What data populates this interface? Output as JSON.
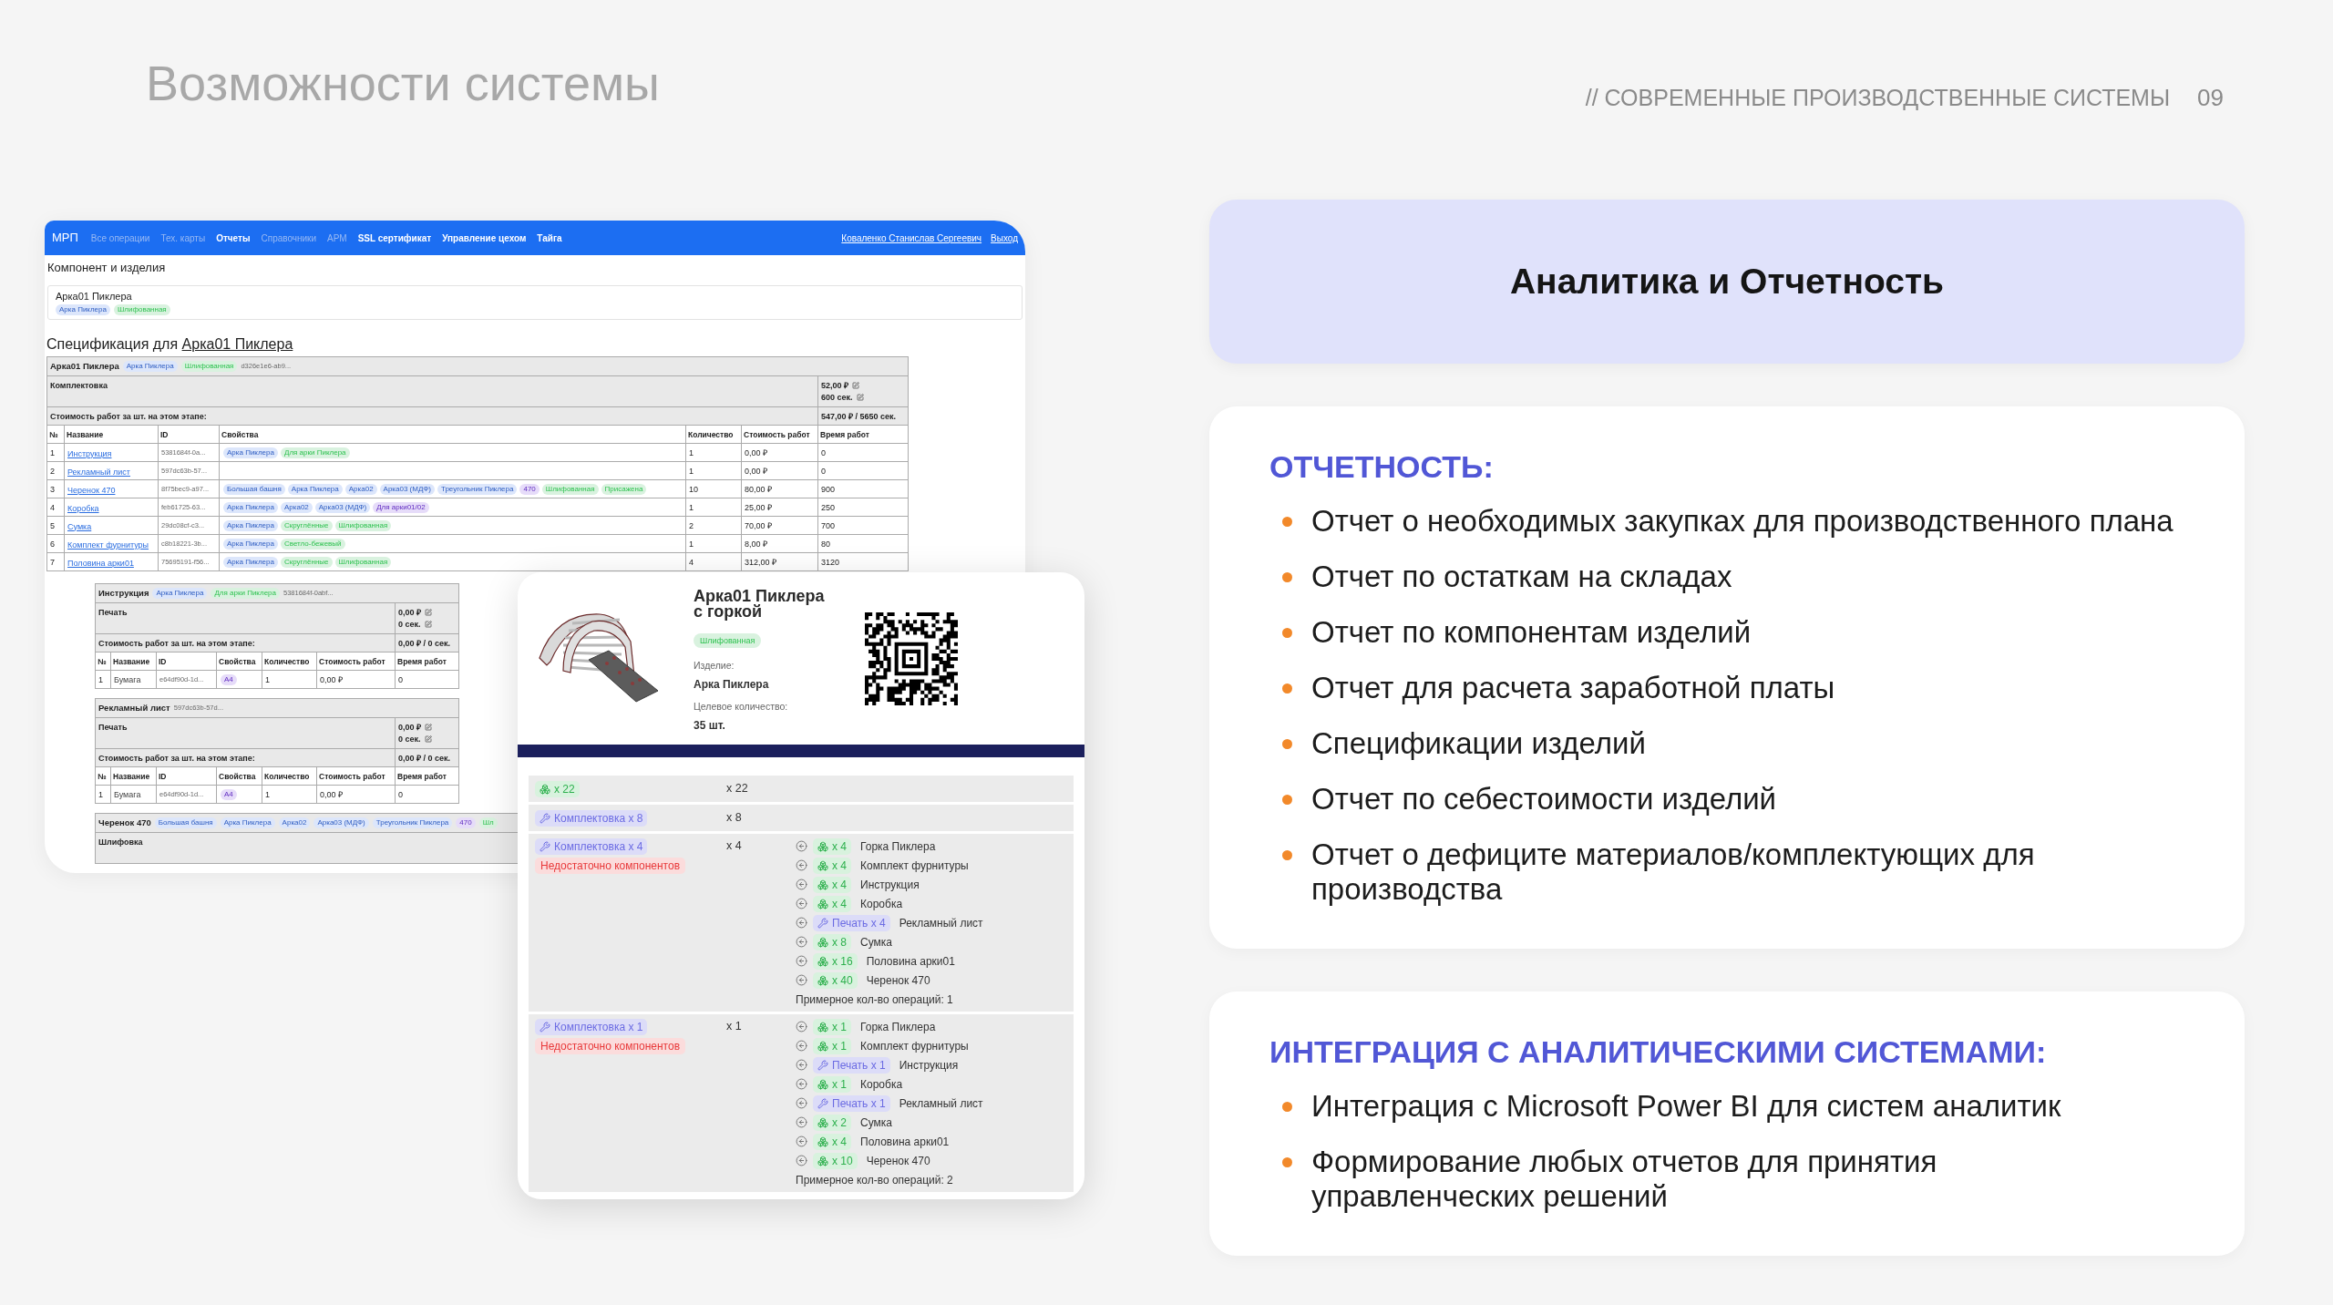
{
  "header": {
    "title": "Возможности системы",
    "subtitle": "// СОВРЕМЕННЫЕ ПРОИЗВОДСТВЕННЫЕ СИСТЕМЫ",
    "page_number": "09"
  },
  "app_screenshot": {
    "nav": {
      "brand": "МРП",
      "items": [
        {
          "label": "Все операции",
          "disabled": true
        },
        {
          "label": "Тех. карты",
          "disabled": true
        },
        {
          "label": "Отчеты",
          "disabled": false
        },
        {
          "label": "Справочники",
          "disabled": true
        },
        {
          "label": "АРМ",
          "disabled": true
        },
        {
          "label": "SSL сертификат",
          "disabled": false
        },
        {
          "label": "Управление цехом",
          "disabled": false
        },
        {
          "label": "Тайга",
          "disabled": false
        }
      ],
      "user": "Коваленко Станислав Сергеевич",
      "logout": "Выход"
    },
    "page_title": "Компонент и изделия",
    "product": {
      "name": "Арка01 Пиклера",
      "tags": [
        {
          "label": "Арка Пиклера",
          "color": "#dce6fb"
        },
        {
          "label": "Шлифованная",
          "color": "#d9f2df"
        }
      ]
    },
    "spec_heading": {
      "text": "Спецификация для",
      "link": "Арка01 Пиклера"
    },
    "spec": {
      "name": "Арка01 Пиклера",
      "tags": [
        {
          "label": "Арка Пиклера",
          "color": "#dce6fb"
        },
        {
          "label": "Шлифованная",
          "color": "#d9f2df"
        }
      ],
      "id": "d326e1e6-ab9...",
      "stage": "Комплектовка",
      "stage_cost": "52,00 ₽",
      "stage_time": "600 сек.",
      "total_label": "Стоимость работ за шт. на этом этапе:",
      "total_value": "547,00 ₽ / 5650 сек.",
      "columns": [
        "№",
        "Название",
        "ID",
        "Свойства",
        "Количество",
        "Стоимость работ",
        "Время работ"
      ],
      "rows": [
        {
          "number": "1",
          "name": "Инструкция",
          "id": "5381684f-0a...",
          "tags": [
            {
              "label": "Арка Пиклера",
              "color": "#dce6fb"
            },
            {
              "label": "Для арки Пиклера",
              "color": "#d9f2df"
            }
          ],
          "quantity": "1",
          "cost": "0,00 ₽",
          "time": "0"
        },
        {
          "number": "2",
          "name": "Рекламный лист",
          "id": "597dc63b-57...",
          "quantity": "1",
          "cost": "0,00 ₽",
          "time": "0"
        },
        {
          "number": "3",
          "name": "Черенок 470",
          "id": "8f75bec9-a97...",
          "tags": [
            {
              "label": "Большая башня",
              "color": "#dce6fb"
            },
            {
              "label": "Арка Пиклера",
              "color": "#dce6fb"
            },
            {
              "label": "Арка02",
              "color": "#dce6fb"
            },
            {
              "label": "Арка03 (МДФ)",
              "color": "#dce6fb"
            },
            {
              "label": "Треугольник Пиклера",
              "color": "#dce6fb"
            },
            {
              "label": "470",
              "color": "#e6dcf9"
            },
            {
              "label": "Шлифованная",
              "color": "#d9f2df"
            },
            {
              "label": "Присажена",
              "color": "#d9f2df"
            }
          ],
          "quantity": "10",
          "cost": "80,00 ₽",
          "time": "900"
        },
        {
          "number": "4",
          "name": "Коробка",
          "id": "feb61725-63...",
          "tags": [
            {
              "label": "Арка Пиклера",
              "color": "#dce6fb"
            },
            {
              "label": "Арка02",
              "color": "#dce6fb"
            },
            {
              "label": "Арка03 (МДФ)",
              "color": "#dce6fb"
            },
            {
              "label": "Для арки01/02",
              "color": "#e6dcf9"
            }
          ],
          "quantity": "1",
          "cost": "25,00 ₽",
          "time": "250"
        },
        {
          "number": "5",
          "name": "Сумка",
          "id": "29dc08cf-c3...",
          "tags": [
            {
              "label": "Арка Пиклера",
              "color": "#dce6fb"
            },
            {
              "label": "Скруглённые",
              "color": "#d9f2df"
            },
            {
              "label": "Шлифованная",
              "color": "#d9f2df"
            }
          ],
          "quantity": "2",
          "cost": "70,00 ₽",
          "time": "700"
        },
        {
          "number": "6",
          "name": "Комплект фурнитуры",
          "id": "c8b18221-3b...",
          "tags": [
            {
              "label": "Арка Пиклера",
              "color": "#dce6fb"
            },
            {
              "label": "Светло-бежевый",
              "color": "#d9f2df"
            }
          ],
          "quantity": "1",
          "cost": "8,00 ₽",
          "time": "80"
        },
        {
          "number": "7",
          "name": "Половина арки01",
          "id": "75695191-f56...",
          "tags": [
            {
              "label": "Арка Пиклера",
              "color": "#dce6fb"
            },
            {
              "label": "Скруглённые",
              "color": "#d9f2df"
            },
            {
              "label": "Шлифованная",
              "color": "#d9f2df"
            }
          ],
          "quantity": "4",
          "cost": "312,00 ₽",
          "time": "3120"
        }
      ]
    },
    "sub_specs": [
      {
        "name": "Инструкция",
        "tags": [
          {
            "label": "Арка Пиклера",
            "color": "#dce6fb"
          },
          {
            "label": "Для арки Пиклера",
            "color": "#d9f2df"
          }
        ],
        "id": "5381684f-0abf...",
        "stage": "Печать",
        "stage_cost": "0,00 ₽",
        "stage_time": "0 сек.",
        "total_label": "Стоимость работ за шт. на этом этапе:",
        "total_value": "0,00 ₽ / 0 сек.",
        "columns": [
          "№",
          "Название",
          "ID",
          "Свойства",
          "Количество",
          "Стоимость работ",
          "Время работ"
        ],
        "rows": [
          {
            "number": "1",
            "name": "Бумага",
            "id": "e64df90d-1d...",
            "tags": [
              {
                "label": "А4",
                "color": "#e6dcf9"
              }
            ],
            "quantity": "1",
            "cost": "0,00 ₽",
            "time": "0"
          }
        ]
      },
      {
        "name": "Рекламный лист",
        "id": "597dc63b-57d...",
        "stage": "Печать",
        "stage_cost": "0,00 ₽",
        "stage_time": "0 сек.",
        "total_label": "Стоимость работ за шт. на этом этапе:",
        "total_value": "0,00 ₽ / 0 сек.",
        "columns": [
          "№",
          "Название",
          "ID",
          "Свойства",
          "Количество",
          "Стоимость работ",
          "Время работ"
        ],
        "rows": [
          {
            "number": "1",
            "name": "Бумага",
            "id": "e64df90d-1d...",
            "tags": [
              {
                "label": "А4",
                "color": "#e6dcf9"
              }
            ],
            "quantity": "1",
            "cost": "0,00 ₽",
            "time": "0"
          }
        ]
      },
      {
        "name": "Черенок 470",
        "tags": [
          {
            "label": "Большая башня",
            "color": "#dce6fb"
          },
          {
            "label": "Арка Пиклера",
            "color": "#dce6fb"
          },
          {
            "label": "Арка02",
            "color": "#dce6fb"
          },
          {
            "label": "Арка03 (МДФ)",
            "color": "#dce6fb"
          },
          {
            "label": "Треугольник Пиклера",
            "color": "#dce6fb"
          },
          {
            "label": "470",
            "color": "#e6dcf9"
          },
          {
            "label": "Шл",
            "color": "#d9f2df"
          }
        ],
        "stage": "Шлифовка"
      }
    ]
  },
  "task_card": {
    "title": "Арка01 Пиклера с горкой",
    "tag": {
      "label": "Шлифованная",
      "color": "#d9f2df"
    },
    "fields": [
      {
        "label": "Изделие:",
        "value": "Арка Пиклера"
      },
      {
        "label": "Целевое количество:",
        "value": "35 шт."
      }
    ],
    "operations": [
      {
        "badge": {
          "kind": "stock",
          "text": "x 22"
        },
        "quantity": "x 22"
      },
      {
        "badge": {
          "kind": "operation",
          "text": "Комплектовка x 8"
        },
        "quantity": "x 8"
      },
      {
        "badge": {
          "kind": "operation",
          "text": "Комплектовка x 4"
        },
        "warning": "Недостаточно компонентов",
        "quantity": "x 4",
        "components": [
          {
            "kind": "stock",
            "badge": "x 4",
            "name": "Горка Пиклера"
          },
          {
            "kind": "stock",
            "badge": "x 4",
            "name": "Комплект фурнитуры"
          },
          {
            "kind": "stock",
            "badge": "x 4",
            "name": "Инструкция"
          },
          {
            "kind": "stock",
            "badge": "x 4",
            "name": "Коробка"
          },
          {
            "kind": "operation",
            "badge": "Печать x 4",
            "name": "Рекламный лист"
          },
          {
            "kind": "stock",
            "badge": "x 8",
            "name": "Сумка"
          },
          {
            "kind": "stock",
            "badge": "x 16",
            "name": "Половина арки01"
          },
          {
            "kind": "stock",
            "badge": "x 40",
            "name": "Черенок 470"
          }
        ],
        "estimate": "Примерное кол-во операций: 1"
      },
      {
        "badge": {
          "kind": "operation",
          "text": "Комплектовка x 1"
        },
        "warning": "Недостаточно компонентов",
        "quantity": "x 1",
        "components": [
          {
            "kind": "stock",
            "badge": "x 1",
            "name": "Горка Пиклера"
          },
          {
            "kind": "stock",
            "badge": "x 1",
            "name": "Комплект фурнитуры"
          },
          {
            "kind": "operation",
            "badge": "Печать x 1",
            "name": "Инструкция"
          },
          {
            "kind": "stock",
            "badge": "x 1",
            "name": "Коробка"
          },
          {
            "kind": "operation",
            "badge": "Печать x 1",
            "name": "Рекламный лист"
          },
          {
            "kind": "stock",
            "badge": "x 2",
            "name": "Сумка"
          },
          {
            "kind": "stock",
            "badge": "x 4",
            "name": "Половина арки01"
          },
          {
            "kind": "stock",
            "badge": "x 10",
            "name": "Черенок 470"
          }
        ],
        "estimate": "Примерное кол-во операций: 2"
      }
    ]
  },
  "feature_title": "Аналитика и Отчетность",
  "sections": [
    {
      "heading": "ОТЧЕТНОСТЬ:",
      "items": [
        "Отчет о необходимых закупках для производственного плана",
        "Отчет по остаткам на складах",
        "Отчет по компонентам изделий",
        "Отчет для расчета заработной платы",
        "Спецификации изделий",
        "Отчет по себестоимости изделий",
        "Отчет о дефиците материалов/комплектующих для производства"
      ]
    },
    {
      "heading": "ИНТЕГРАЦИЯ С АНАЛИТИЧЕСКИМИ СИСТЕМАМИ:",
      "items": [
        "Интеграция с Microsoft Power BI для систем аналитик",
        "Формирование любых отчетов для принятия управленческих решений"
      ]
    }
  ]
}
